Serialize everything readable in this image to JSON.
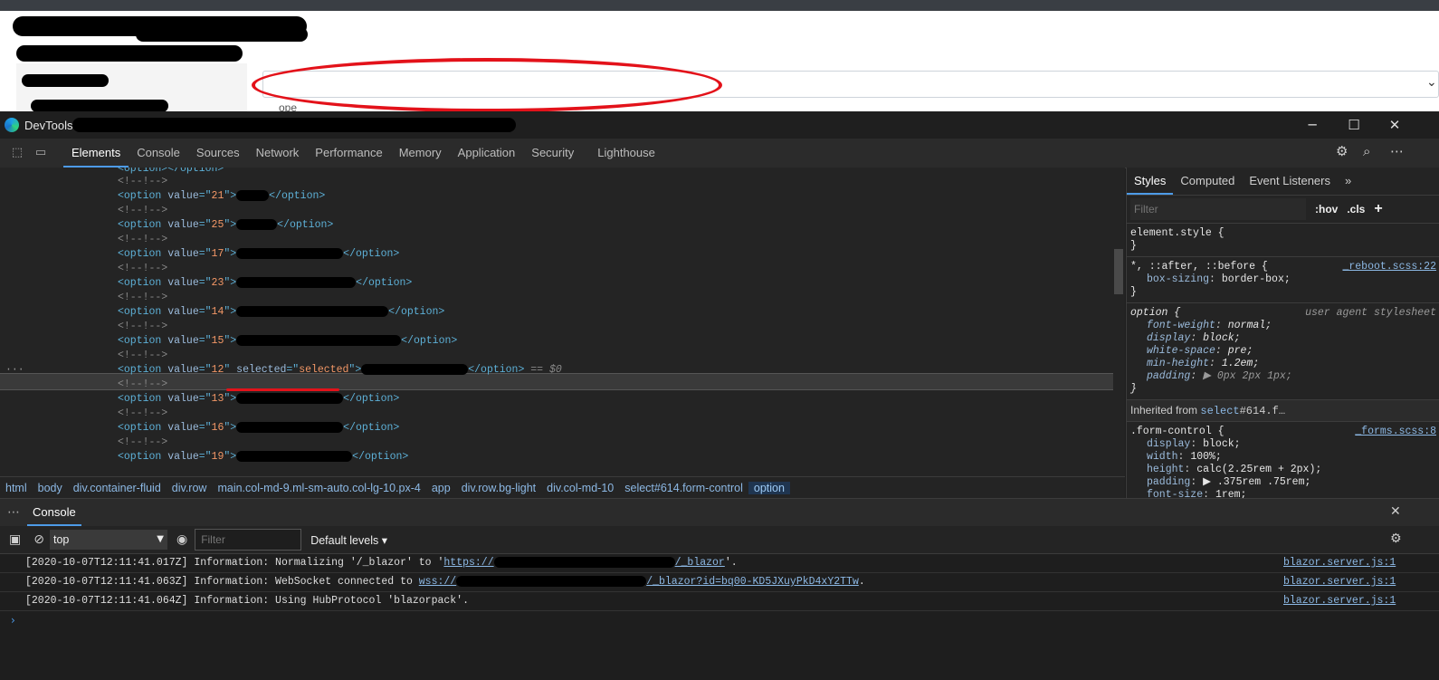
{
  "devtools": {
    "title": "DevTools -",
    "window_controls": {
      "minimize": "─",
      "maximize": "☐",
      "close": "✕"
    },
    "tabs": [
      "Elements",
      "Console",
      "Sources",
      "Network",
      "Performance",
      "Memory",
      "Application",
      "Security",
      "Lighthouse"
    ],
    "active_tab": "Elements"
  },
  "elements": {
    "lines": [
      {
        "kind": "option_open_close",
        "text": "<option></option>"
      },
      {
        "kind": "comment",
        "text": "<!--!-->"
      },
      {
        "kind": "option",
        "value": "21"
      },
      {
        "kind": "comment",
        "text": "<!--!-->"
      },
      {
        "kind": "option",
        "value": "25"
      },
      {
        "kind": "comment",
        "text": "<!--!-->"
      },
      {
        "kind": "option",
        "value": "17"
      },
      {
        "kind": "comment",
        "text": "<!--!-->"
      },
      {
        "kind": "option",
        "value": "23"
      },
      {
        "kind": "comment",
        "text": "<!--!-->"
      },
      {
        "kind": "option",
        "value": "14"
      },
      {
        "kind": "comment",
        "text": "<!--!-->"
      },
      {
        "kind": "option",
        "value": "15"
      },
      {
        "kind": "comment",
        "text": "<!--!-->"
      },
      {
        "kind": "option_selected",
        "value": "12",
        "selected": "selected",
        "suffix": "== $0"
      },
      {
        "kind": "comment",
        "text": "<!--!-->"
      },
      {
        "kind": "option",
        "value": "13"
      },
      {
        "kind": "comment",
        "text": "<!--!-->"
      },
      {
        "kind": "option",
        "value": "16"
      },
      {
        "kind": "comment",
        "text": "<!--!-->"
      },
      {
        "kind": "option",
        "value": "19"
      }
    ],
    "selected_row_dots": "···",
    "breadcrumb": [
      "html",
      "body",
      "div.container-fluid",
      "div.row",
      "main.col-md-9.ml-sm-auto.col-lg-10.px-4",
      "app",
      "div.row.bg-light",
      "div.col-md-10",
      "select#614.form-control",
      "option"
    ]
  },
  "styles": {
    "tabs": [
      "Styles",
      "Computed",
      "Event Listeners",
      "»"
    ],
    "filter_placeholder": "Filter",
    "hov": ":hov",
    "cls": ".cls",
    "plus": "+",
    "element_style": "element.style {",
    "close_brace": "}",
    "rule1": {
      "selector": "*, ::after, ::before {",
      "source": "_reboot.scss:22",
      "props": [
        [
          "box-sizing",
          "border-box;"
        ]
      ]
    },
    "rule2": {
      "selector": "option {",
      "source": "user agent stylesheet",
      "props": [
        [
          "font-weight",
          "normal;"
        ],
        [
          "display",
          "block;"
        ],
        [
          "white-space",
          "pre;"
        ],
        [
          "min-height",
          "1.2em;"
        ],
        [
          "padding",
          "▶ 0px 2px 1px;"
        ]
      ]
    },
    "inherited_label": "Inherited from",
    "inherited_link": "select",
    "inherited_link_rest": "#614.f…",
    "rule3": {
      "selector": ".form-control {",
      "source": "_forms.scss:8",
      "props": [
        [
          "display",
          "block;"
        ],
        [
          "width",
          "100%;"
        ],
        [
          "height",
          "calc(2.25rem + 2px);"
        ],
        [
          "padding",
          "▶ .375rem .75rem;"
        ],
        [
          "font-size",
          "1rem;"
        ]
      ]
    }
  },
  "console": {
    "drawer_tab": "Console",
    "context": "top",
    "filter_placeholder": "Filter",
    "levels": "Default levels ▾",
    "messages": [
      {
        "text_a": "[2020-10-07T12:11:41.017Z] Information: Normalizing '/_blazor' to '",
        "link": "https://",
        "link_tail": "/_blazor",
        "text_b": "'.",
        "source": "blazor.server.js:1"
      },
      {
        "text_a": "[2020-10-07T12:11:41.063Z] Information: WebSocket connected to ",
        "link": "wss://",
        "link_tail": "/_blazor?id=bq00-KD5JXuyPkD4xY2TTw",
        "text_b": ".",
        "source": "blazor.server.js:1"
      },
      {
        "text_a": "[2020-10-07T12:11:41.064Z] Information: Using HubProtocol 'blazorpack'.",
        "link": "",
        "link_tail": "",
        "text_b": "",
        "source": "blazor.server.js:1"
      }
    ],
    "prompt": "›"
  },
  "page": {
    "label_fragment": "ope"
  },
  "colors": {
    "accent": "#4d9be8",
    "annotation_red": "#e3121a",
    "tag": "#5db0d7",
    "attr": "#9bbbdc",
    "value": "#f29766"
  }
}
